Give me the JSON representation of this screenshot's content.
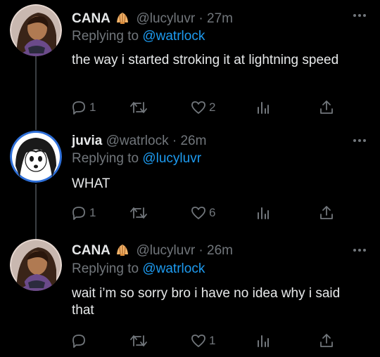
{
  "tweets": [
    {
      "name": "CANA",
      "handle": "@lucyluvr · 27m",
      "replying_prefix": "Replying to",
      "replying_to": "@watrlock",
      "text": "the way i started stroking it at lightning speed",
      "replies": "1",
      "retweets": "",
      "likes": "2"
    },
    {
      "name": "juvia",
      "handle": "@watrlock · 26m",
      "replying_prefix": "Replying to",
      "replying_to": "@lucyluvr",
      "text": "WHAT",
      "replies": "1",
      "retweets": "",
      "likes": "6"
    },
    {
      "name": "CANA",
      "handle": "@lucyluvr · 26m",
      "replying_prefix": "Replying to",
      "replying_to": "@watrlock",
      "text": "wait i’m so sorry bro i have no idea why i said that",
      "replies": "",
      "retweets": "",
      "likes": "1"
    }
  ],
  "icons": {
    "more": "more-horizontal-icon",
    "reply": "reply-icon",
    "retweet": "retweet-icon",
    "like": "heart-icon",
    "stats": "stats-icon",
    "share": "share-icon",
    "badge": "shell-emoji-icon"
  },
  "colors": {
    "background": "#000000",
    "text": "#e7e9ea",
    "muted": "#71767b",
    "link": "#1d9bf0"
  }
}
